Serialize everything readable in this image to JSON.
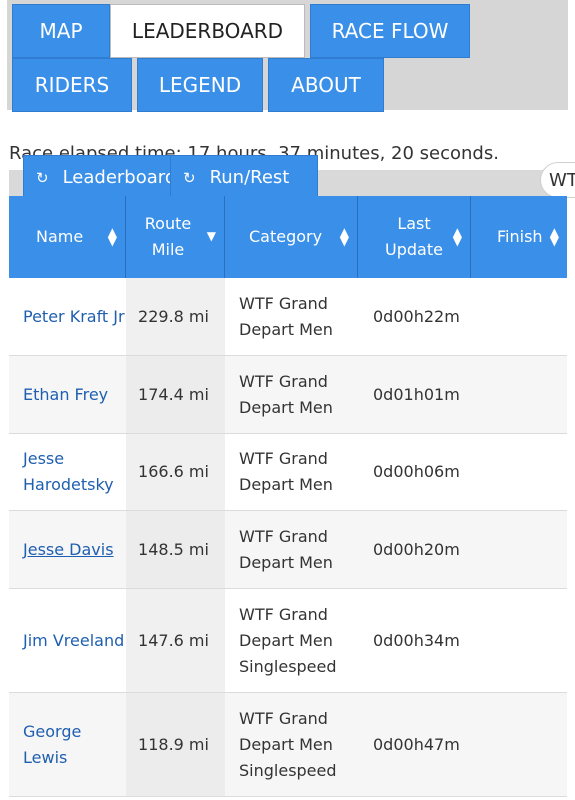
{
  "tabs": {
    "map": "MAP",
    "leaderboard": "LEADERBOARD",
    "race_flow": "RACE FLOW",
    "riders": "RIDERS",
    "legend": "LEGEND",
    "about": "ABOUT"
  },
  "elapsed_text": "Race elapsed time: 17 hours, 37 minutes, 20 seconds.",
  "toolbar": {
    "leaderboard_label": "Leaderboard",
    "runrest_label": "Run/Rest",
    "pill_label": "WT"
  },
  "table": {
    "headers": {
      "name": "Name",
      "route_mile_1": "Route",
      "route_mile_2": "Mile",
      "category": "Category",
      "last_update_1": "Last",
      "last_update_2": "Update",
      "finish": "Finish"
    },
    "rows": [
      {
        "name": "Peter Kraft Jr",
        "mile": "229.8 mi",
        "category": "WTF Grand Depart Men",
        "update": "0d00h22m",
        "finish": ""
      },
      {
        "name": "Ethan Frey",
        "mile": "174.4 mi",
        "category": "WTF Grand Depart Men",
        "update": "0d01h01m",
        "finish": ""
      },
      {
        "name": "Jesse Harodetsky",
        "mile": "166.6 mi",
        "category": "WTF Grand Depart Men",
        "update": "0d00h06m",
        "finish": ""
      },
      {
        "name": "Jesse Davis",
        "mile": "148.5 mi",
        "category": "WTF Grand Depart Men",
        "update": "0d00h20m",
        "finish": ""
      },
      {
        "name": "Jim Vreeland",
        "mile": "147.6 mi",
        "category": "WTF Grand Depart Men Singlespeed",
        "update": "0d00h34m",
        "finish": ""
      },
      {
        "name": "George Lewis",
        "mile": "118.9 mi",
        "category": "WTF Grand Depart Men Singlespeed",
        "update": "0d00h47m",
        "finish": ""
      }
    ]
  },
  "colors": {
    "accent": "#3a8fe8",
    "link": "#1f5fb0"
  }
}
